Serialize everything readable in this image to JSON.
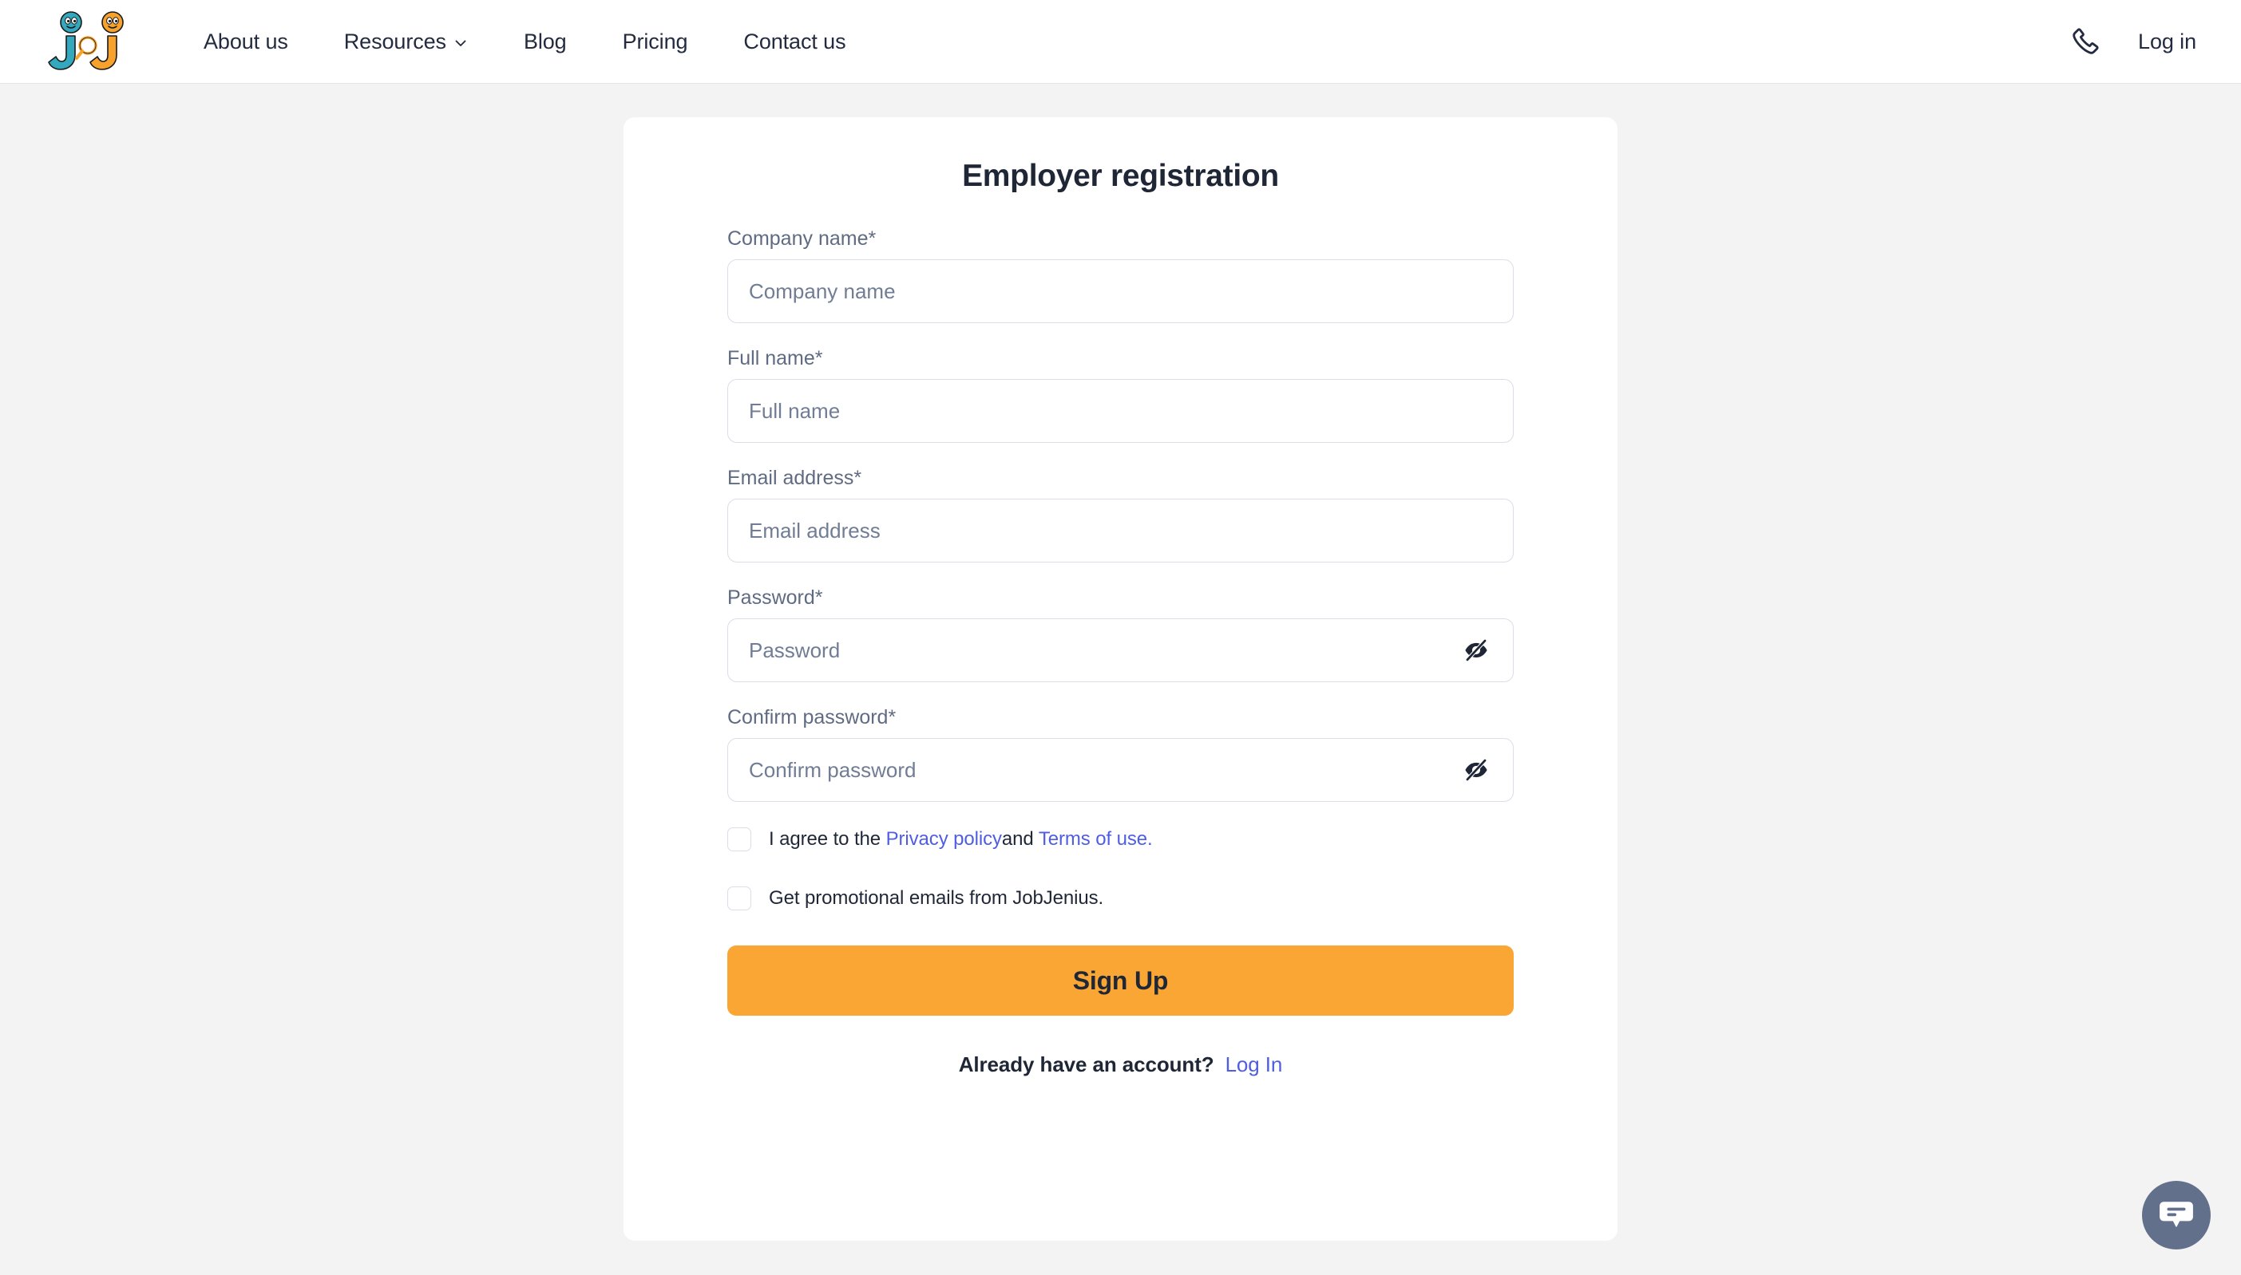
{
  "header": {
    "logo_alt": "JobJenius logo",
    "nav": [
      {
        "label": "About us",
        "has_chevron": false
      },
      {
        "label": "Resources",
        "has_chevron": true
      },
      {
        "label": "Blog",
        "has_chevron": false
      },
      {
        "label": "Pricing",
        "has_chevron": false
      },
      {
        "label": "Contact us",
        "has_chevron": false
      }
    ],
    "phone_icon": "phone-icon",
    "login_label": "Log in"
  },
  "card": {
    "title": "Employer registration",
    "fields": [
      {
        "label": "Company name*",
        "placeholder": "Company name",
        "value": "",
        "type": "text",
        "has_eye": false
      },
      {
        "label": "Full name*",
        "placeholder": "Full name",
        "value": "",
        "type": "text",
        "has_eye": false
      },
      {
        "label": "Email address*",
        "placeholder": "Email address",
        "value": "",
        "type": "email",
        "has_eye": false
      },
      {
        "label": "Password*",
        "placeholder": "Password",
        "value": "",
        "type": "password",
        "has_eye": true
      },
      {
        "label": "Confirm password*",
        "placeholder": "Confirm password",
        "value": "",
        "type": "password",
        "has_eye": true
      }
    ],
    "terms": {
      "prefix": "I agree to the ",
      "privacy_link": "Privacy policy",
      "middle": "and ",
      "terms_link": "Terms of use.",
      "checked": false
    },
    "promo": {
      "label": "Get promotional emails from JobJenius.",
      "checked": false
    },
    "submit_label": "Sign Up",
    "footer_text": "Already have an account?",
    "footer_link": "Log In"
  },
  "chat": {
    "icon": "chat-bubble-icon"
  },
  "colors": {
    "page_bg": "#f3f3f4",
    "card_bg": "#ffffff",
    "accent_orange": "#faa634",
    "link_blue": "#4f5ee0",
    "text_dark": "#1f2737",
    "label_gray": "#5f6b82",
    "border_gray": "#d9dee7",
    "chat_slate": "#62708c",
    "logo_teal": "#34a8bd",
    "logo_orange": "#f6a22c"
  }
}
